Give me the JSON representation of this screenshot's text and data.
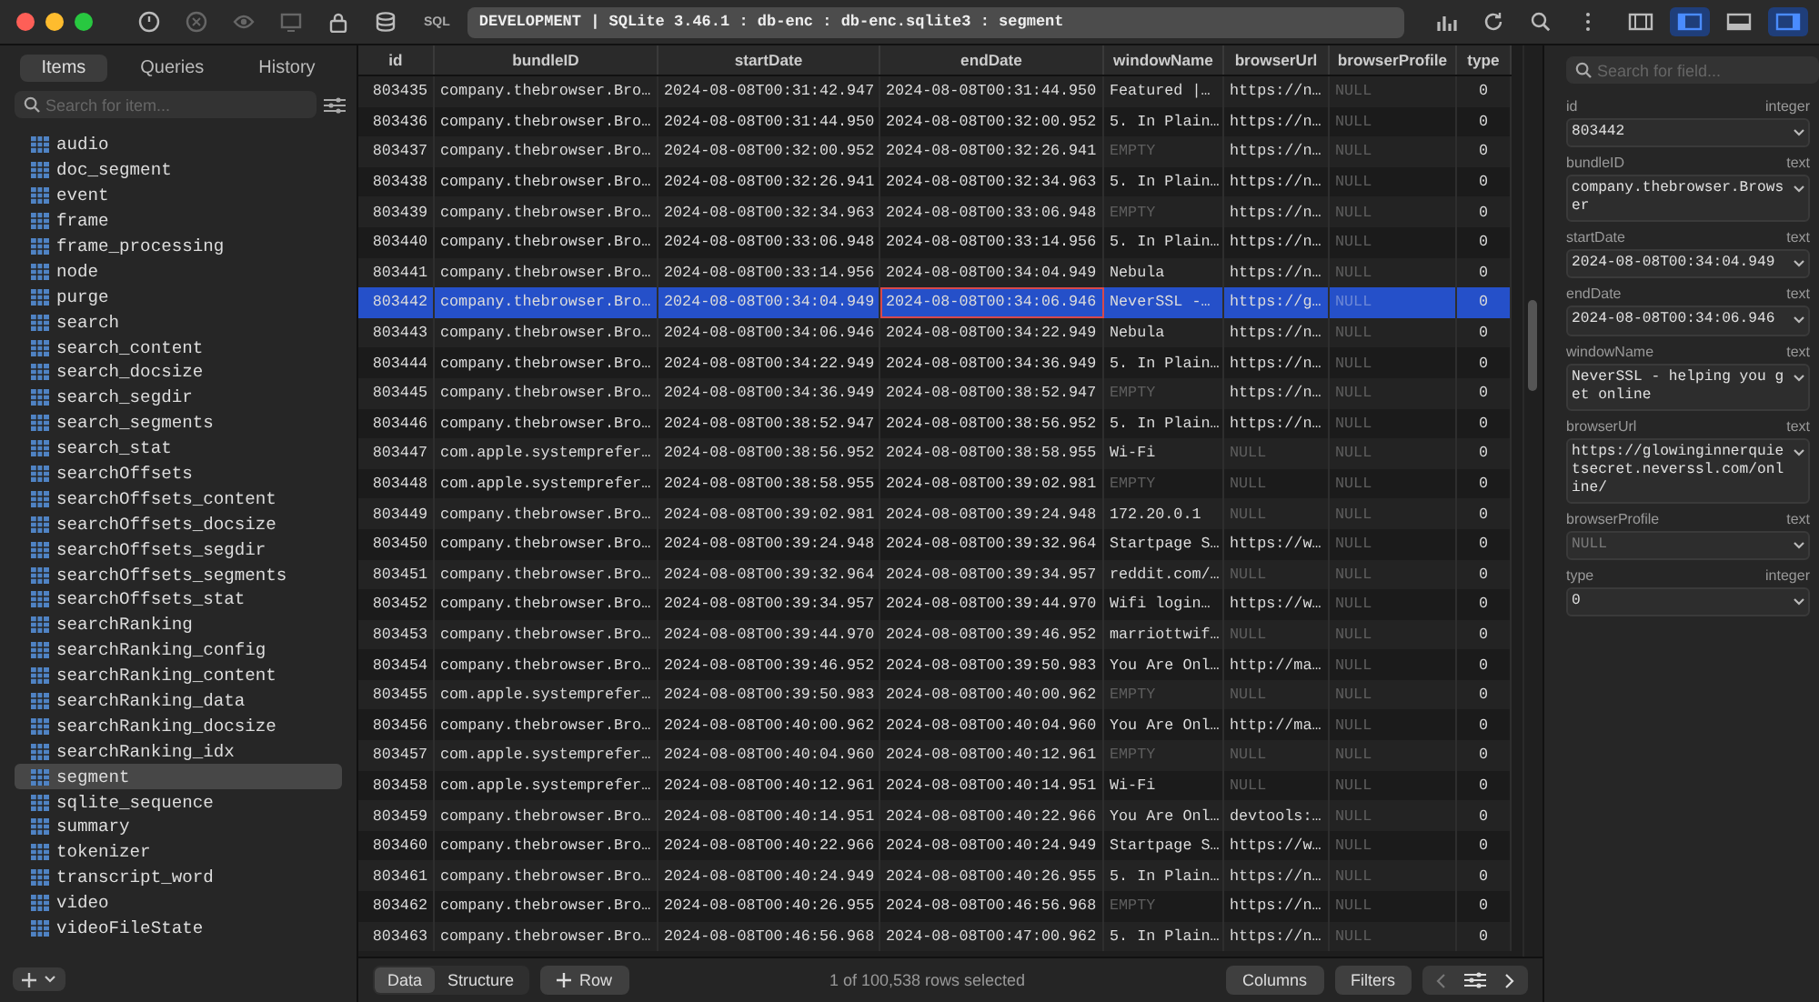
{
  "toolbar": {
    "sql_label": "SQL",
    "path": "DEVELOPMENT | SQLite 3.46.1 : db-enc : db-enc.sqlite3 : segment",
    "layout_toggles": [
      {
        "on": false
      },
      {
        "on": true
      },
      {
        "on": false
      },
      {
        "on": true
      }
    ]
  },
  "sidebar": {
    "tabs": [
      {
        "label": "Items",
        "selected": true
      },
      {
        "label": "Queries",
        "selected": false
      },
      {
        "label": "History",
        "selected": false
      }
    ],
    "search": {
      "placeholder": "Search for item..."
    },
    "items": [
      {
        "name": "audio",
        "selected": false
      },
      {
        "name": "doc_segment",
        "selected": false
      },
      {
        "name": "event",
        "selected": false
      },
      {
        "name": "frame",
        "selected": false
      },
      {
        "name": "frame_processing",
        "selected": false
      },
      {
        "name": "node",
        "selected": false
      },
      {
        "name": "purge",
        "selected": false
      },
      {
        "name": "search",
        "selected": false
      },
      {
        "name": "search_content",
        "selected": false
      },
      {
        "name": "search_docsize",
        "selected": false
      },
      {
        "name": "search_segdir",
        "selected": false
      },
      {
        "name": "search_segments",
        "selected": false
      },
      {
        "name": "search_stat",
        "selected": false
      },
      {
        "name": "searchOffsets",
        "selected": false
      },
      {
        "name": "searchOffsets_content",
        "selected": false
      },
      {
        "name": "searchOffsets_docsize",
        "selected": false
      },
      {
        "name": "searchOffsets_segdir",
        "selected": false
      },
      {
        "name": "searchOffsets_segments",
        "selected": false
      },
      {
        "name": "searchOffsets_stat",
        "selected": false
      },
      {
        "name": "searchRanking",
        "selected": false
      },
      {
        "name": "searchRanking_config",
        "selected": false
      },
      {
        "name": "searchRanking_content",
        "selected": false
      },
      {
        "name": "searchRanking_data",
        "selected": false
      },
      {
        "name": "searchRanking_docsize",
        "selected": false
      },
      {
        "name": "searchRanking_idx",
        "selected": false
      },
      {
        "name": "segment",
        "selected": true
      },
      {
        "name": "sqlite_sequence",
        "selected": false
      },
      {
        "name": "summary",
        "selected": false
      },
      {
        "name": "tokenizer",
        "selected": false
      },
      {
        "name": "transcript_word",
        "selected": false
      },
      {
        "name": "video",
        "selected": false
      },
      {
        "name": "videoFileState",
        "selected": false
      }
    ]
  },
  "table": {
    "columns": [
      "id",
      "bundleID",
      "startDate",
      "endDate",
      "windowName",
      "browserUrl",
      "browserProfile",
      "type"
    ],
    "rows": [
      {
        "selected": false,
        "cells": [
          "803435",
          "company.thebrowser.Bro…",
          "2024-08-08T00:31:42.947",
          "2024-08-08T00:31:44.950",
          "Featured |…",
          "https://n…",
          {
            "text": "NULL",
            "muted": true
          },
          "0"
        ]
      },
      {
        "selected": false,
        "cells": [
          "803436",
          "company.thebrowser.Bro…",
          "2024-08-08T00:31:44.950",
          "2024-08-08T00:32:00.952",
          "5. In Plain…",
          "https://n…",
          {
            "text": "NULL",
            "muted": true
          },
          "0"
        ]
      },
      {
        "selected": false,
        "cells": [
          "803437",
          "company.thebrowser.Bro…",
          "2024-08-08T00:32:00.952",
          "2024-08-08T00:32:26.941",
          {
            "text": "EMPTY",
            "muted": true
          },
          "https://n…",
          {
            "text": "NULL",
            "muted": true
          },
          "0"
        ]
      },
      {
        "selected": false,
        "cells": [
          "803438",
          "company.thebrowser.Bro…",
          "2024-08-08T00:32:26.941",
          "2024-08-08T00:32:34.963",
          "5. In Plain…",
          "https://n…",
          {
            "text": "NULL",
            "muted": true
          },
          "0"
        ]
      },
      {
        "selected": false,
        "cells": [
          "803439",
          "company.thebrowser.Bro…",
          "2024-08-08T00:32:34.963",
          "2024-08-08T00:33:06.948",
          {
            "text": "EMPTY",
            "muted": true
          },
          "https://n…",
          {
            "text": "NULL",
            "muted": true
          },
          "0"
        ]
      },
      {
        "selected": false,
        "cells": [
          "803440",
          "company.thebrowser.Bro…",
          "2024-08-08T00:33:06.948",
          "2024-08-08T00:33:14.956",
          "5. In Plain…",
          "https://n…",
          {
            "text": "NULL",
            "muted": true
          },
          "0"
        ]
      },
      {
        "selected": false,
        "cells": [
          "803441",
          "company.thebrowser.Bro…",
          "2024-08-08T00:33:14.956",
          "2024-08-08T00:34:04.949",
          "Nebula",
          "https://n…",
          {
            "text": "NULL",
            "muted": true
          },
          "0"
        ]
      },
      {
        "selected": true,
        "cells": [
          "803442",
          "company.thebrowser.Bro…",
          "2024-08-08T00:34:04.949",
          {
            "text": "2024-08-08T00:34:06.946",
            "focused": true
          },
          "NeverSSL -…",
          "https://g…",
          {
            "text": "NULL",
            "muted": true
          },
          "0"
        ]
      },
      {
        "selected": false,
        "cells": [
          "803443",
          "company.thebrowser.Bro…",
          "2024-08-08T00:34:06.946",
          "2024-08-08T00:34:22.949",
          "Nebula",
          "https://n…",
          {
            "text": "NULL",
            "muted": true
          },
          "0"
        ]
      },
      {
        "selected": false,
        "cells": [
          "803444",
          "company.thebrowser.Bro…",
          "2024-08-08T00:34:22.949",
          "2024-08-08T00:34:36.949",
          "5. In Plain…",
          "https://n…",
          {
            "text": "NULL",
            "muted": true
          },
          "0"
        ]
      },
      {
        "selected": false,
        "cells": [
          "803445",
          "company.thebrowser.Bro…",
          "2024-08-08T00:34:36.949",
          "2024-08-08T00:38:52.947",
          {
            "text": "EMPTY",
            "muted": true
          },
          "https://n…",
          {
            "text": "NULL",
            "muted": true
          },
          "0"
        ]
      },
      {
        "selected": false,
        "cells": [
          "803446",
          "company.thebrowser.Bro…",
          "2024-08-08T00:38:52.947",
          "2024-08-08T00:38:56.952",
          "5. In Plain…",
          "https://n…",
          {
            "text": "NULL",
            "muted": true
          },
          "0"
        ]
      },
      {
        "selected": false,
        "cells": [
          "803447",
          "com.apple.systemprefer…",
          "2024-08-08T00:38:56.952",
          "2024-08-08T00:38:58.955",
          "Wi-Fi",
          {
            "text": "NULL",
            "muted": true
          },
          {
            "text": "NULL",
            "muted": true
          },
          "0"
        ]
      },
      {
        "selected": false,
        "cells": [
          "803448",
          "com.apple.systemprefer…",
          "2024-08-08T00:38:58.955",
          "2024-08-08T00:39:02.981",
          {
            "text": "EMPTY",
            "muted": true
          },
          {
            "text": "NULL",
            "muted": true
          },
          {
            "text": "NULL",
            "muted": true
          },
          "0"
        ]
      },
      {
        "selected": false,
        "cells": [
          "803449",
          "company.thebrowser.Bro…",
          "2024-08-08T00:39:02.981",
          "2024-08-08T00:39:24.948",
          "172.20.0.1",
          {
            "text": "NULL",
            "muted": true
          },
          {
            "text": "NULL",
            "muted": true
          },
          "0"
        ]
      },
      {
        "selected": false,
        "cells": [
          "803450",
          "company.thebrowser.Bro…",
          "2024-08-08T00:39:24.948",
          "2024-08-08T00:39:32.964",
          "Startpage S…",
          "https://w…",
          {
            "text": "NULL",
            "muted": true
          },
          "0"
        ]
      },
      {
        "selected": false,
        "cells": [
          "803451",
          "company.thebrowser.Bro…",
          "2024-08-08T00:39:32.964",
          "2024-08-08T00:39:34.957",
          "reddit.com/…",
          {
            "text": "NULL",
            "muted": true
          },
          {
            "text": "NULL",
            "muted": true
          },
          "0"
        ]
      },
      {
        "selected": false,
        "cells": [
          "803452",
          "company.thebrowser.Bro…",
          "2024-08-08T00:39:34.957",
          "2024-08-08T00:39:44.970",
          "Wifi login…",
          "https://w…",
          {
            "text": "NULL",
            "muted": true
          },
          "0"
        ]
      },
      {
        "selected": false,
        "cells": [
          "803453",
          "company.thebrowser.Bro…",
          "2024-08-08T00:39:44.970",
          "2024-08-08T00:39:46.952",
          "marriottwif…",
          {
            "text": "NULL",
            "muted": true
          },
          {
            "text": "NULL",
            "muted": true
          },
          "0"
        ]
      },
      {
        "selected": false,
        "cells": [
          "803454",
          "company.thebrowser.Bro…",
          "2024-08-08T00:39:46.952",
          "2024-08-08T00:39:50.983",
          "You Are Onl…",
          "http://ma…",
          {
            "text": "NULL",
            "muted": true
          },
          "0"
        ]
      },
      {
        "selected": false,
        "cells": [
          "803455",
          "com.apple.systemprefer…",
          "2024-08-08T00:39:50.983",
          "2024-08-08T00:40:00.962",
          {
            "text": "EMPTY",
            "muted": true
          },
          {
            "text": "NULL",
            "muted": true
          },
          {
            "text": "NULL",
            "muted": true
          },
          "0"
        ]
      },
      {
        "selected": false,
        "cells": [
          "803456",
          "company.thebrowser.Bro…",
          "2024-08-08T00:40:00.962",
          "2024-08-08T00:40:04.960",
          "You Are Onl…",
          "http://ma…",
          {
            "text": "NULL",
            "muted": true
          },
          "0"
        ]
      },
      {
        "selected": false,
        "cells": [
          "803457",
          "com.apple.systemprefer…",
          "2024-08-08T00:40:04.960",
          "2024-08-08T00:40:12.961",
          {
            "text": "EMPTY",
            "muted": true
          },
          {
            "text": "NULL",
            "muted": true
          },
          {
            "text": "NULL",
            "muted": true
          },
          "0"
        ]
      },
      {
        "selected": false,
        "cells": [
          "803458",
          "com.apple.systemprefer…",
          "2024-08-08T00:40:12.961",
          "2024-08-08T00:40:14.951",
          "Wi-Fi",
          {
            "text": "NULL",
            "muted": true
          },
          {
            "text": "NULL",
            "muted": true
          },
          "0"
        ]
      },
      {
        "selected": false,
        "cells": [
          "803459",
          "company.thebrowser.Bro…",
          "2024-08-08T00:40:14.951",
          "2024-08-08T00:40:22.966",
          "You Are Onl…",
          "devtools:…",
          {
            "text": "NULL",
            "muted": true
          },
          "0"
        ]
      },
      {
        "selected": false,
        "cells": [
          "803460",
          "company.thebrowser.Bro…",
          "2024-08-08T00:40:22.966",
          "2024-08-08T00:40:24.949",
          "Startpage S…",
          "https://w…",
          {
            "text": "NULL",
            "muted": true
          },
          "0"
        ]
      },
      {
        "selected": false,
        "cells": [
          "803461",
          "company.thebrowser.Bro…",
          "2024-08-08T00:40:24.949",
          "2024-08-08T00:40:26.955",
          "5. In Plain…",
          "https://n…",
          {
            "text": "NULL",
            "muted": true
          },
          "0"
        ]
      },
      {
        "selected": false,
        "cells": [
          "803462",
          "company.thebrowser.Bro…",
          "2024-08-08T00:40:26.955",
          "2024-08-08T00:46:56.968",
          {
            "text": "EMPTY",
            "muted": true
          },
          "https://n…",
          {
            "text": "NULL",
            "muted": true
          },
          "0"
        ]
      },
      {
        "selected": false,
        "cells": [
          "803463",
          "company.thebrowser.Bro…",
          "2024-08-08T00:46:56.968",
          "2024-08-08T00:47:00.962",
          "5. In Plain…",
          "https://n…",
          {
            "text": "NULL",
            "muted": true
          },
          "0"
        ]
      }
    ]
  },
  "bottom_bar": {
    "view_tabs": [
      {
        "label": "Data",
        "selected": true
      },
      {
        "label": "Structure",
        "selected": false
      }
    ],
    "add_row_label": "Row",
    "status": "1 of 100,538 rows selected",
    "buttons": [
      "Columns",
      "Filters"
    ]
  },
  "inspector": {
    "search": {
      "placeholder": "Search for field..."
    },
    "fields": [
      {
        "name": "id",
        "type": "integer",
        "value": "803442",
        "muted": false
      },
      {
        "name": "bundleID",
        "type": "text",
        "value": "company.thebrowser.Browser",
        "muted": false
      },
      {
        "name": "startDate",
        "type": "text",
        "value": "2024-08-08T00:34:04.949",
        "muted": false
      },
      {
        "name": "endDate",
        "type": "text",
        "value": "2024-08-08T00:34:06.946",
        "muted": false
      },
      {
        "name": "windowName",
        "type": "text",
        "value": "NeverSSL - helping you get online",
        "muted": false
      },
      {
        "name": "browserUrl",
        "type": "text",
        "value": "https://glowinginnerquietsecret.neverssl.com/online/",
        "muted": false
      },
      {
        "name": "browserProfile",
        "type": "text",
        "value": "NULL",
        "muted": true
      },
      {
        "name": "type",
        "type": "integer",
        "value": "0",
        "muted": false
      }
    ]
  }
}
